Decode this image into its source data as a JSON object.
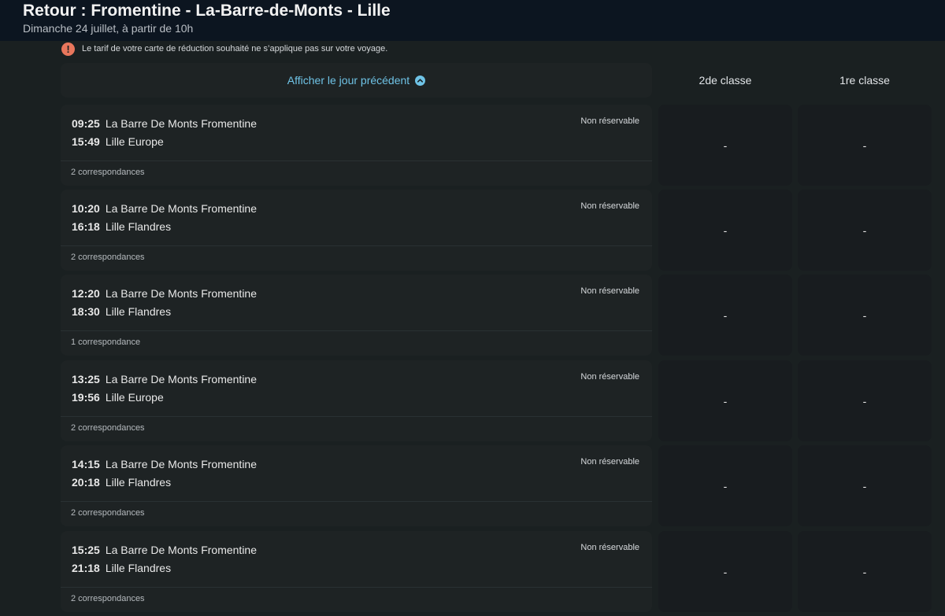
{
  "header": {
    "title": "Retour : Fromentine - La-Barre-de-Monts - Lille",
    "subtitle": "Dimanche 24 juillet, à partir de 10h"
  },
  "warning": {
    "text": "Le tarif de votre carte de réduction souhaité ne s’applique pas sur votre voyage.",
    "icon": "!"
  },
  "prev_day": {
    "label": "Afficher le jour précédent"
  },
  "classes": {
    "second": "2de classe",
    "first": "1re classe"
  },
  "journeys": [
    {
      "dep_time": "09:25",
      "dep_station": "La Barre De Monts Fromentine",
      "arr_time": "15:49",
      "arr_station": "Lille Europe",
      "status": "Non réservable",
      "connections": "2 correspondances",
      "price_second": "-",
      "price_first": "-"
    },
    {
      "dep_time": "10:20",
      "dep_station": "La Barre De Monts Fromentine",
      "arr_time": "16:18",
      "arr_station": "Lille Flandres",
      "status": "Non réservable",
      "connections": "2 correspondances",
      "price_second": "-",
      "price_first": "-"
    },
    {
      "dep_time": "12:20",
      "dep_station": "La Barre De Monts Fromentine",
      "arr_time": "18:30",
      "arr_station": "Lille Flandres",
      "status": "Non réservable",
      "connections": "1 correspondance",
      "price_second": "-",
      "price_first": "-"
    },
    {
      "dep_time": "13:25",
      "dep_station": "La Barre De Monts Fromentine",
      "arr_time": "19:56",
      "arr_station": "Lille Europe",
      "status": "Non réservable",
      "connections": "2 correspondances",
      "price_second": "-",
      "price_first": "-"
    },
    {
      "dep_time": "14:15",
      "dep_station": "La Barre De Monts Fromentine",
      "arr_time": "20:18",
      "arr_station": "Lille Flandres",
      "status": "Non réservable",
      "connections": "2 correspondances",
      "price_second": "-",
      "price_first": "-"
    },
    {
      "dep_time": "15:25",
      "dep_station": "La Barre De Monts Fromentine",
      "arr_time": "21:18",
      "arr_station": "Lille Flandres",
      "status": "Non réservable",
      "connections": "2 correspondances",
      "price_second": "-",
      "price_first": "-"
    }
  ]
}
